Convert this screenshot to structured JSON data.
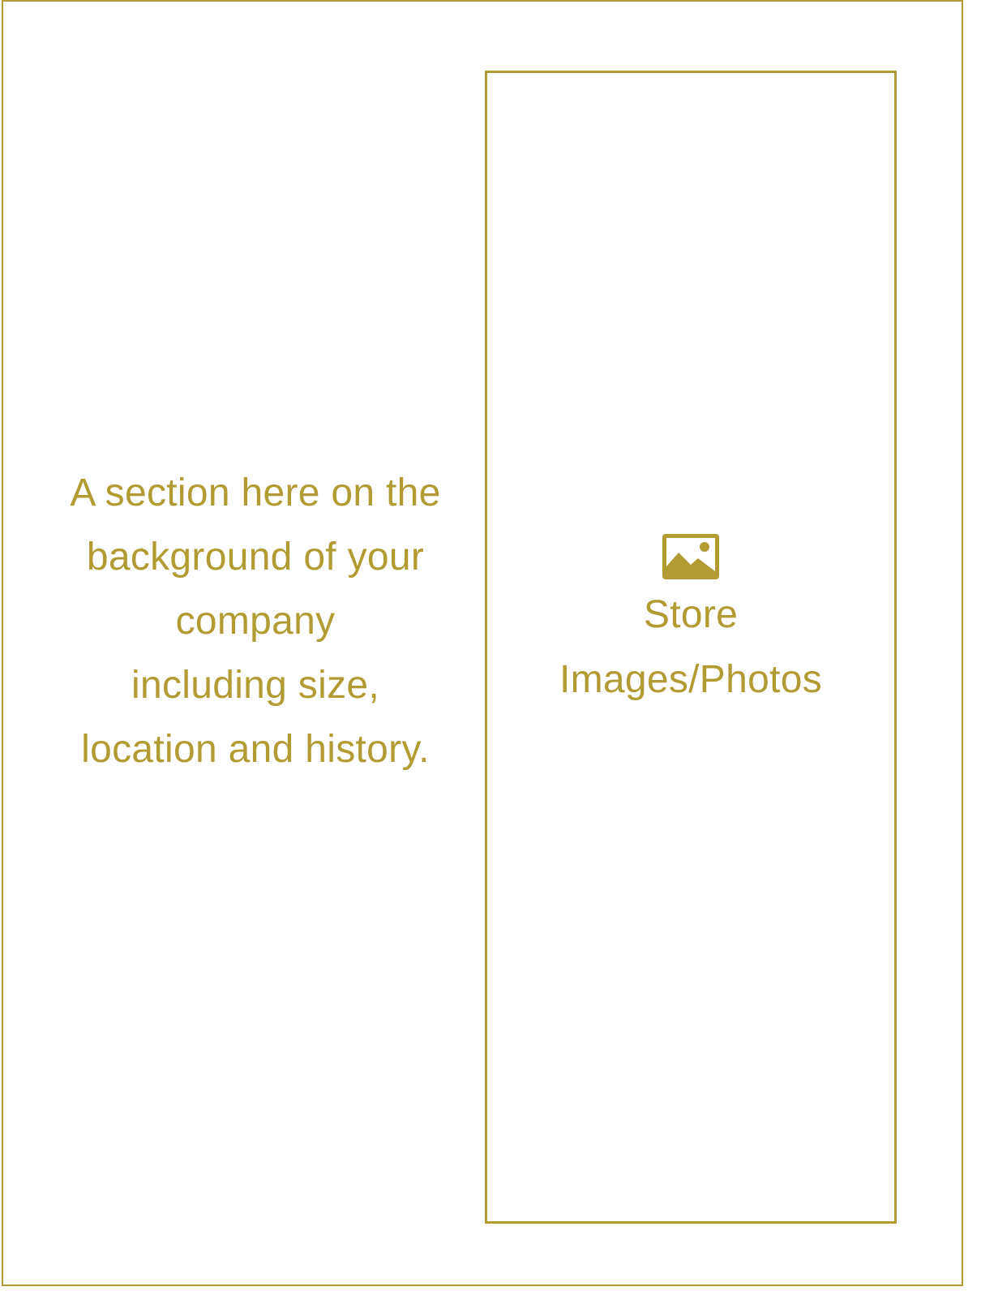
{
  "section": {
    "lines": [
      "A section here on the",
      "background of your",
      "company",
      "including size,",
      "location and history."
    ]
  },
  "image_placeholder": {
    "icon": "image-icon",
    "label_lines": [
      "Store",
      "Images/Photos"
    ]
  },
  "colors": {
    "accent": "#b29b32",
    "background": "#ffffff"
  }
}
